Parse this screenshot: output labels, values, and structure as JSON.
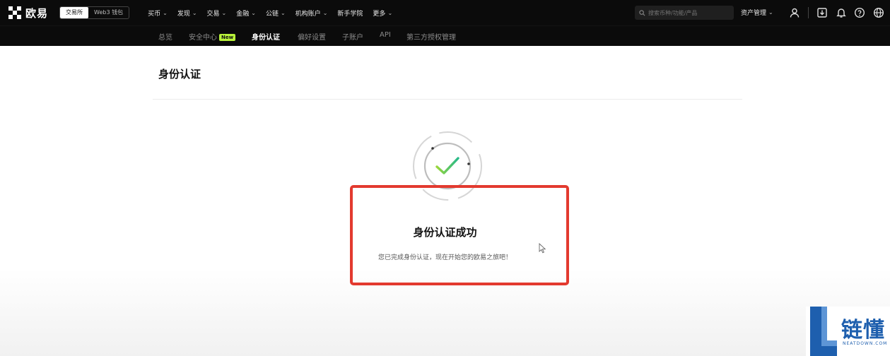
{
  "brand": {
    "logo_text": "欧易"
  },
  "mode_switch": {
    "options": [
      "交易所",
      "Web3 钱包"
    ],
    "active": 0
  },
  "top_nav": [
    {
      "label": "买币",
      "dropdown": true
    },
    {
      "label": "发现",
      "dropdown": true
    },
    {
      "label": "交易",
      "dropdown": true
    },
    {
      "label": "金融",
      "dropdown": true
    },
    {
      "label": "公链",
      "dropdown": true
    },
    {
      "label": "机构账户",
      "dropdown": true
    },
    {
      "label": "新手学院",
      "dropdown": false
    },
    {
      "label": "更多",
      "dropdown": true
    }
  ],
  "search": {
    "placeholder": "搜索币种/功能/产品"
  },
  "assets_menu": {
    "label": "资产管理"
  },
  "header_icons": [
    "user-icon",
    "download-icon",
    "bell-icon",
    "help-icon",
    "globe-icon"
  ],
  "sub_nav": {
    "items": [
      {
        "label": "总览"
      },
      {
        "label": "安全中心",
        "badge": "New"
      },
      {
        "label": "身份认证",
        "active": true
      },
      {
        "label": "偏好设置"
      },
      {
        "label": "子账户"
      },
      {
        "label": "API"
      },
      {
        "label": "第三方授权管理"
      }
    ]
  },
  "page": {
    "title": "身份认证"
  },
  "result": {
    "title": "身份认证成功",
    "description": "您已完成身份认证，现在开始您的欧易之旅吧！"
  },
  "colors": {
    "badge_new": "#b8f23a",
    "highlight_box": "#e33a2f",
    "check_start": "#9ad63a",
    "check_end": "#27b98a",
    "watermark_blue": "#1e5fae"
  },
  "watermark": {
    "cn": "链懂",
    "en": "NEATDOWN.COM"
  }
}
